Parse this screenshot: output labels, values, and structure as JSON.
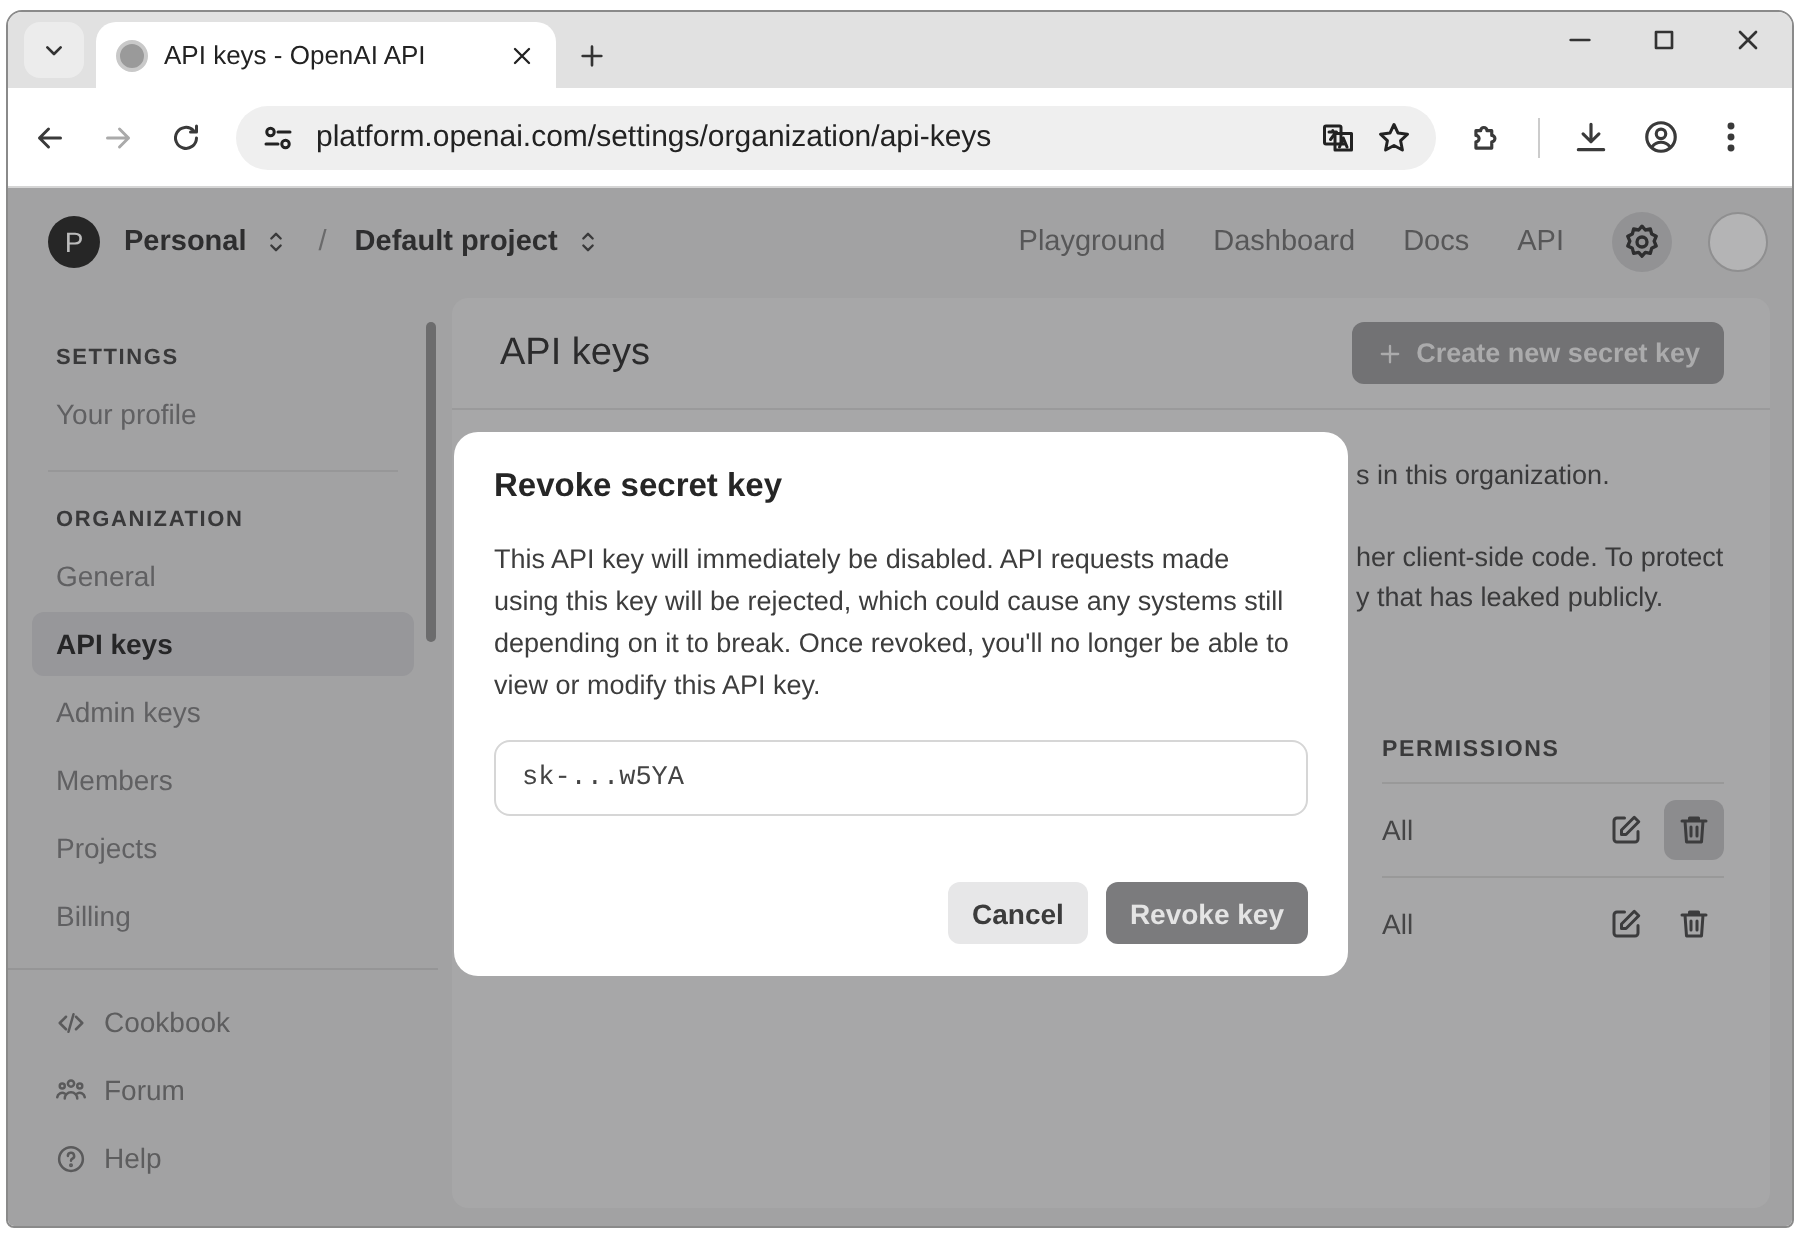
{
  "browser": {
    "tabs": [
      {
        "title": "API keys - OpenAI API",
        "selected": true
      }
    ],
    "url": "platform.openai.com/settings/organization/api-keys"
  },
  "header": {
    "avatar_letter": "P",
    "separator": "/",
    "organization": "Personal",
    "project": "Default project",
    "nav": [
      "Playground",
      "Dashboard",
      "Docs",
      "API"
    ]
  },
  "sidebar": {
    "sections": [
      {
        "heading": "SETTINGS",
        "items": [
          {
            "label": "Your profile",
            "selected": false
          }
        ]
      },
      {
        "heading": "ORGANIZATION",
        "items": [
          {
            "label": "General",
            "selected": false
          },
          {
            "label": "API keys",
            "selected": true
          },
          {
            "label": "Admin keys",
            "selected": false
          },
          {
            "label": "Members",
            "selected": false
          },
          {
            "label": "Projects",
            "selected": false
          },
          {
            "label": "Billing",
            "selected": false
          }
        ]
      }
    ],
    "links": [
      {
        "label": "Cookbook",
        "kind": "code"
      },
      {
        "label": "Forum",
        "kind": "people"
      },
      {
        "label": "Help",
        "kind": "help"
      }
    ]
  },
  "main": {
    "title": "API keys",
    "create_button": "Create new secret key",
    "text_fragments": [
      "s in this organization.",
      "her client-side code. To protect",
      "y that has leaked publicly."
    ],
    "table": {
      "columns": [
        "PERMISSIONS"
      ],
      "rows": [
        {
          "permissions": "All",
          "delete_hovered": true
        },
        {
          "permissions": "All",
          "delete_hovered": false
        }
      ]
    }
  },
  "dialog": {
    "title": "Revoke secret key",
    "body": "This API key will immediately be disabled. API requests made using this key will be rejected, which could cause any systems still depending on it to break. Once revoked, you'll no longer be able to view or modify this API key.",
    "key": "sk-...w5YA",
    "buttons": [
      {
        "label": "Cancel",
        "kind": "secondary"
      },
      {
        "label": "Revoke key",
        "kind": "primary"
      }
    ]
  }
}
